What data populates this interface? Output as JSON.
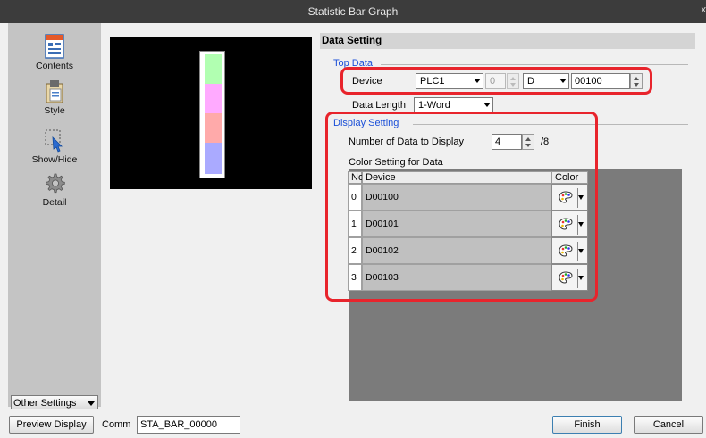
{
  "window": {
    "title": "Statistic Bar Graph",
    "close_glyph": "x"
  },
  "sidebar": {
    "items": [
      {
        "label": "Contents",
        "icon": "contents-icon"
      },
      {
        "label": "Style",
        "icon": "style-icon"
      },
      {
        "label": "Show/Hide",
        "icon": "show-hide-icon"
      },
      {
        "label": "Detail",
        "icon": "gear-icon"
      }
    ],
    "other_settings_label": "Other Settings"
  },
  "preview": {
    "segment_colors": [
      "#b1ffb1",
      "#ffaaff",
      "#ffaaaa",
      "#aaaaff"
    ]
  },
  "data_setting": {
    "header": "Data Setting",
    "top_data": {
      "group_label": "Top Data",
      "device_label": "Device",
      "plc": "PLC1",
      "station": "0",
      "device_type": "D",
      "address": "00100",
      "data_length_label": "Data Length",
      "data_length": "1-Word"
    },
    "display_setting": {
      "group_label": "Display Setting",
      "num_data_label": "Number of Data to Display",
      "num_data_value": "4",
      "num_data_max": "/8",
      "color_setting_label": "Color Setting for Data",
      "columns": [
        "No.",
        "Device",
        "Color"
      ],
      "rows": [
        {
          "no": "0",
          "device": "D00100"
        },
        {
          "no": "1",
          "device": "D00101"
        },
        {
          "no": "2",
          "device": "D00102"
        },
        {
          "no": "3",
          "device": "D00103"
        }
      ]
    }
  },
  "bottom": {
    "preview_display_label": "Preview Display",
    "comm_label": "Comm",
    "comm_value": "STA_BAR_00000",
    "finish_label": "Finish",
    "cancel_label": "Cancel"
  },
  "colors": {
    "highlight": "#e8242c",
    "group_label": "#1b4fd8"
  }
}
